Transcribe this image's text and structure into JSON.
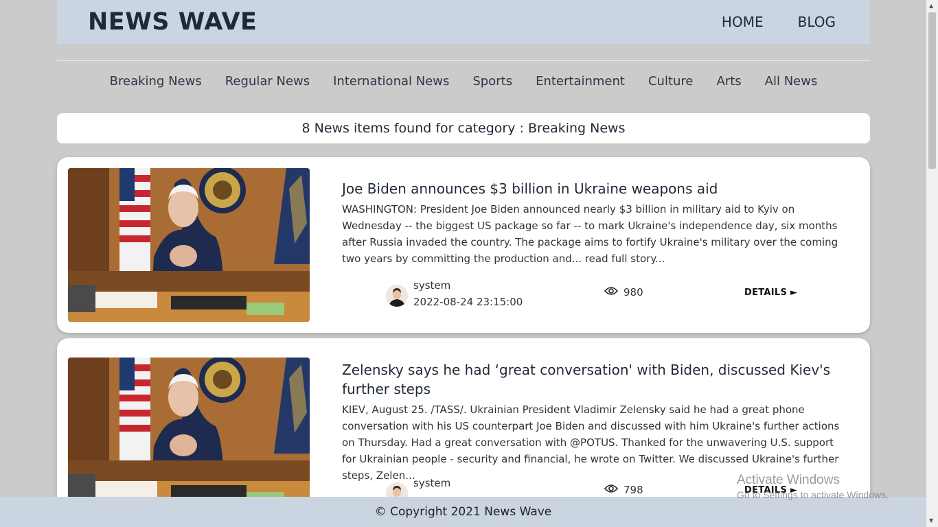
{
  "header": {
    "brand": "NEWS WAVE",
    "nav": [
      "HOME",
      "BLOG"
    ]
  },
  "categories": [
    "Breaking News",
    "Regular News",
    "International News",
    "Sports",
    "Entertainment",
    "Culture",
    "Arts",
    "All News"
  ],
  "found_text": "8 News items found for category : Breaking News",
  "news": [
    {
      "title": "Joe Biden announces $3 billion in Ukraine weapons aid",
      "excerpt": "WASHINGTON: President Joe Biden announced nearly $3 billion in military aid to Kyiv on Wednesday -- the biggest US package so far -- to mark Ukraine's independence day, six months after Russia invaded the country. The package aims to fortify Ukraine's military over the coming two years by committing the production and... read full story...",
      "author": "system",
      "date": "2022-08-24 23:15:00",
      "views": "980",
      "details_label": "DETAILS"
    },
    {
      "title": "Zelensky says he had ‘great conversation' with Biden, discussed Kiev's further steps",
      "excerpt": "KIEV, August 25. /TASS/. Ukrainian President Vladimir Zelensky said he had a great phone conversation with his US counterpart Joe Biden and discussed with him Ukraine's further actions on Thursday. Had a great conversation with @POTUS. Thanked for the unwavering U.S. support for Ukrainian people - security and financial, he wrote on Twitter. We discussed Ukraine's further steps, Zelen...",
      "author": "system",
      "date": "",
      "views": "798",
      "details_label": "DETAILS"
    }
  ],
  "footer": "© Copyright 2021 News Wave",
  "watermark": {
    "line1": "Activate Windows",
    "line2": "Go to Settings to activate Windows."
  },
  "icons": {
    "views": "eye-icon",
    "details": "arrow-right-icon"
  }
}
